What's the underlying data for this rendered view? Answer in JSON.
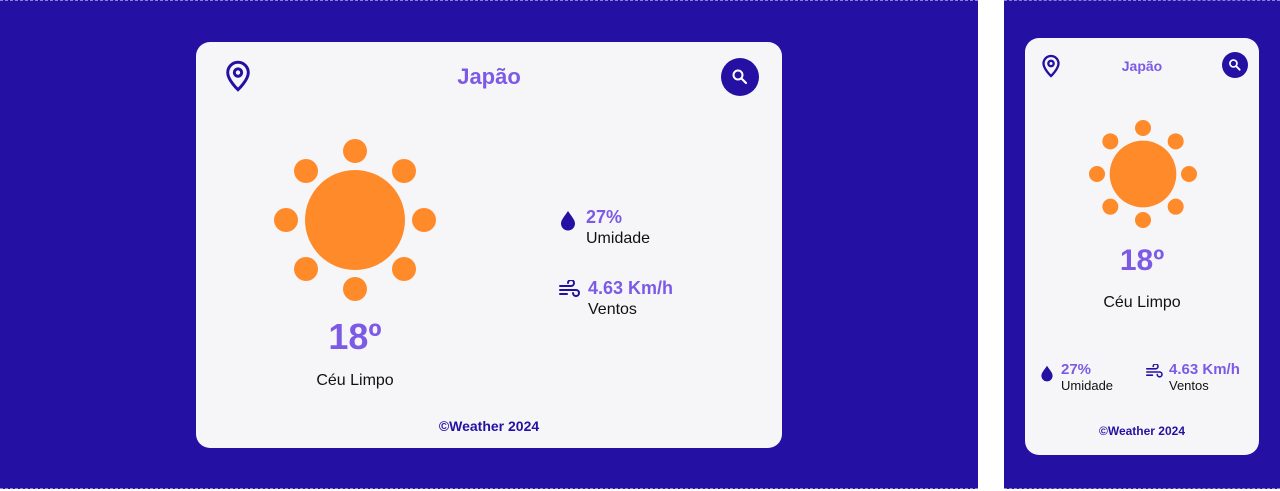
{
  "location": "Japão",
  "temperature": "18º",
  "condition": "Céu Limpo",
  "humidity": {
    "value": "27%",
    "label": "Umidade"
  },
  "wind": {
    "value": "4.63 Km/h",
    "label": "Ventos"
  },
  "footer": "©Weather 2024",
  "colors": {
    "background": "#2411a3",
    "card": "#f6f6f8",
    "accent": "#7c5ae6",
    "sun": "#ff8a2a"
  },
  "icons": {
    "location": "location-pin-icon",
    "search": "search-icon",
    "humidity": "water-drop-icon",
    "wind": "wind-icon",
    "weather": "sun-icon"
  }
}
